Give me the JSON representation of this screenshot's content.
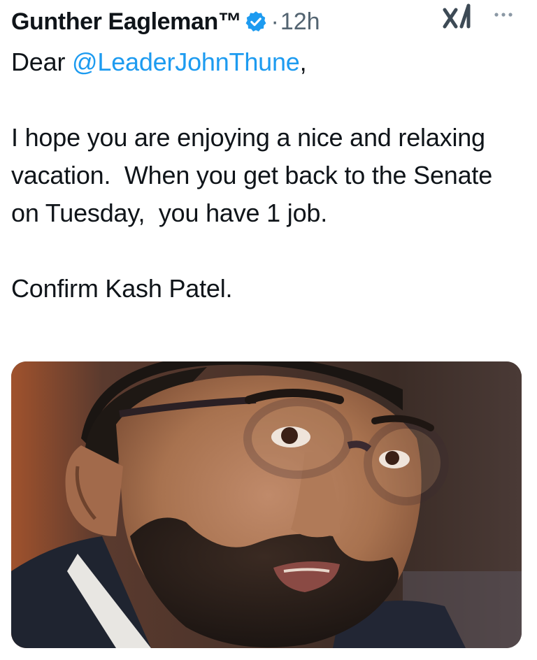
{
  "author": {
    "display_name": "Gunther Eagleman™",
    "verified_icon": "verified-badge-icon",
    "separator": "·",
    "timestamp": "12h"
  },
  "actions": {
    "grok_icon": "grok-icon",
    "more_icon": "more-options-icon"
  },
  "tweet": {
    "greeting_prefix": "Dear ",
    "mention": "@LeaderJohnThune",
    "greeting_suffix": ",",
    "paragraph_1": "I hope you are enjoying a nice and relaxing vacation.  When you get back to the Senate on Tuesday,  you have 1 job.",
    "paragraph_2": "Confirm Kash Patel."
  },
  "media": {
    "type": "photo"
  },
  "colors": {
    "text": "#0f1419",
    "secondary": "#536471",
    "link": "#1d9bf0",
    "verified": "#1d9bf0"
  }
}
